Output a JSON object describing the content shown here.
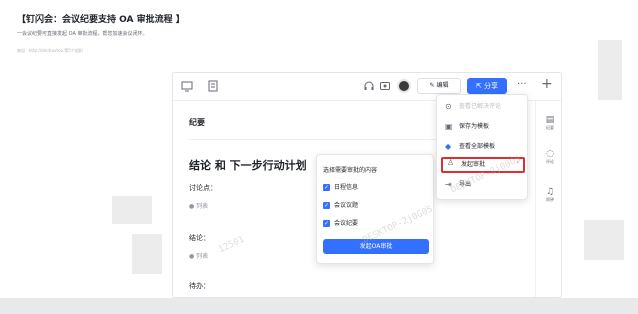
{
  "doc": {
    "title": "【钉闪会：会议纪要支持 OA 审批流程 】",
    "description": "一会议纪要可直接发起 OA 审批流程，帮您加速会议闭环。",
    "meta": "来自 · http://dmitrovtoo 等5个组织"
  },
  "toolbar": {
    "icons": [
      "screen-icon",
      "note-icon",
      "headset-icon",
      "video-icon"
    ],
    "edit_label": "编辑",
    "share_label": "分享",
    "more_label": "···",
    "plus_label": "+"
  },
  "rail": [
    {
      "icon": "document-icon",
      "label": "纪要"
    },
    {
      "icon": "comment-icon",
      "label": "评论"
    },
    {
      "icon": "bell-icon",
      "label": "闹钟"
    }
  ],
  "content": {
    "section_label": "纪要",
    "heading": "结论 和 下一步行动计划",
    "discussion_label": "讨论点：",
    "list_placeholder": "列表",
    "conclusion_label": "结论：",
    "todo_label": "待办："
  },
  "popup": {
    "title": "选择需要审批的内容",
    "options": [
      "日程信息",
      "会议议题",
      "会议纪要"
    ],
    "submit_label": "发起OA审批"
  },
  "menu": {
    "items": [
      {
        "icon": "check-circle-icon",
        "label": "查看已解决评论",
        "disabled": true
      },
      {
        "icon": "save-icon",
        "label": "保存为模板",
        "disabled": false
      },
      {
        "icon": "template-icon",
        "label": "查看全部模板",
        "disabled": false
      },
      {
        "icon": "approval-icon",
        "label": "发起审批",
        "disabled": false,
        "highlighted": true
      },
      {
        "icon": "export-icon",
        "label": "导出",
        "disabled": false
      }
    ]
  },
  "watermark": [
    "DESKTOP-2j00G5",
    "12501",
    "DESKTOP-2j0G05"
  ],
  "colors": {
    "accent": "#3370ff",
    "highlight": "#e02e2e"
  }
}
